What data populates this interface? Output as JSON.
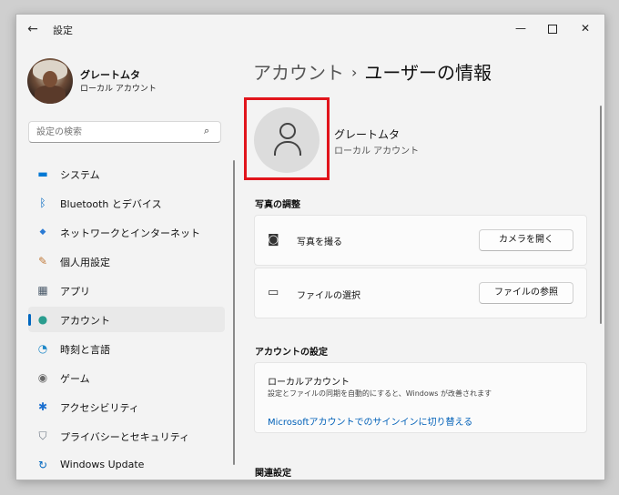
{
  "window": {
    "app_title": "設定",
    "back_glyph": "←",
    "min_glyph": "—",
    "close_glyph": "✕"
  },
  "profile": {
    "name": "グレートムタ",
    "account_type": "ローカル アカウント"
  },
  "search": {
    "placeholder": "設定の検索",
    "icon_glyph": "⌕"
  },
  "sidebar": {
    "items": [
      {
        "label": "システム",
        "icon": "monitor-icon",
        "glyph": "▬",
        "color": "#0078d4"
      },
      {
        "label": "Bluetooth とデバイス",
        "icon": "bluetooth-icon",
        "glyph": "ᛒ",
        "color": "#0067c0"
      },
      {
        "label": "ネットワークとインターネット",
        "icon": "wifi-icon",
        "glyph": "◆",
        "color": "#2b7bd4"
      },
      {
        "label": "個人用設定",
        "icon": "brush-icon",
        "glyph": "✎",
        "color": "#c07a3a"
      },
      {
        "label": "アプリ",
        "icon": "apps-icon",
        "glyph": "▦",
        "color": "#4a5a6a"
      },
      {
        "label": "アカウント",
        "icon": "account-icon",
        "glyph": "●",
        "color": "#2a9d8f"
      },
      {
        "label": "時刻と言語",
        "icon": "globe-clock-icon",
        "glyph": "◔",
        "color": "#1e88c8"
      },
      {
        "label": "ゲーム",
        "icon": "gamepad-icon",
        "glyph": "◉",
        "color": "#6a6a6a"
      },
      {
        "label": "アクセシビリティ",
        "icon": "accessibility-icon",
        "glyph": "✱",
        "color": "#1a6fd0"
      },
      {
        "label": "プライバシーとセキュリティ",
        "icon": "shield-icon",
        "glyph": "⛉",
        "color": "#6a7480"
      },
      {
        "label": "Windows Update",
        "icon": "update-icon",
        "glyph": "↻",
        "color": "#0067c0"
      }
    ],
    "active_index": 5
  },
  "main": {
    "breadcrumb_parent": "アカウント",
    "breadcrumb_sep": "›",
    "breadcrumb_current": "ユーザーの情報",
    "account_name": "グレートムタ",
    "account_type": "ローカル アカウント",
    "photo_section": {
      "title": "写真の調整",
      "take_photo_label": "写真を撮る",
      "camera_button": "カメラを開く",
      "choose_file_label": "ファイルの選択",
      "browse_button": "ファイルの参照"
    },
    "account_settings": {
      "title": "アカウントの設定",
      "local_account_title": "ローカルアカウント",
      "local_account_desc": "設定とファイルの同期を自動的にすると、Windows が改善されます",
      "switch_link": "Microsoftアカウントでのサインインに切り替える"
    },
    "related_title": "関連設定"
  },
  "colors": {
    "accent": "#0067c0",
    "highlight_frame": "#e1141b"
  }
}
